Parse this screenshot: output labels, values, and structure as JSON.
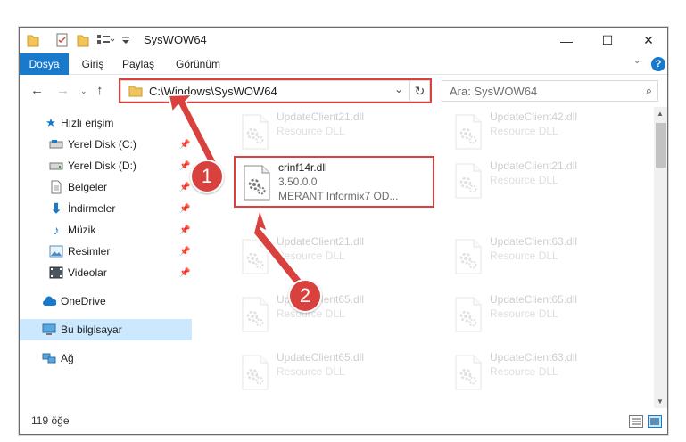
{
  "window": {
    "title": "SysWOW64"
  },
  "ribbon": {
    "tabs": [
      "Dosya",
      "Giriş",
      "Paylaş",
      "Görünüm"
    ]
  },
  "address": {
    "path": "C:\\Windows\\SysWOW64"
  },
  "search": {
    "placeholder": "Ara: SysWOW64"
  },
  "nav": {
    "quick_access": "Hızlı erişim",
    "items": [
      {
        "label": "Yerel Disk (C:)",
        "icon": "drive-icon"
      },
      {
        "label": "Yerel Disk (D:)",
        "icon": "drive-icon"
      },
      {
        "label": "Belgeler",
        "icon": "documents-icon"
      },
      {
        "label": "İndirmeler",
        "icon": "downloads-icon"
      },
      {
        "label": "Müzik",
        "icon": "music-icon"
      },
      {
        "label": "Resimler",
        "icon": "pictures-icon"
      },
      {
        "label": "Videolar",
        "icon": "videos-icon"
      }
    ],
    "onedrive": "OneDrive",
    "this_pc": "Bu bilgisayar",
    "network": "Ağ"
  },
  "files": [
    {
      "name": "UpdateClient21.dll",
      "desc": "Resource DLL"
    },
    {
      "name": "UpdateClient42.dll",
      "desc": "Resource DLL"
    },
    {
      "name": "crinf14r.dll",
      "version": "3.50.0.0",
      "desc": "MERANT Informix7 OD..."
    },
    {
      "name": "UpdateClient21.dll",
      "desc": "Resource DLL"
    },
    {
      "name": "UpdateClient21.dll",
      "desc": "Resource DLL"
    },
    {
      "name": "UpdateClient63.dll",
      "desc": "Resource DLL"
    },
    {
      "name": "UpdateClient65.dll",
      "desc": "Resource DLL"
    },
    {
      "name": "UpdateClient65.dll",
      "desc": "Resource DLL"
    },
    {
      "name": "UpdateClient65.dll",
      "desc": "Resource DLL"
    },
    {
      "name": "UpdateClient63.dll",
      "desc": "Resource DLL"
    }
  ],
  "status": {
    "count": "119 öğe"
  },
  "annotations": {
    "step1": "1",
    "step2": "2"
  },
  "colors": {
    "accent": "#1979ca",
    "highlight": "#d9413f",
    "selection": "#cce8ff"
  }
}
